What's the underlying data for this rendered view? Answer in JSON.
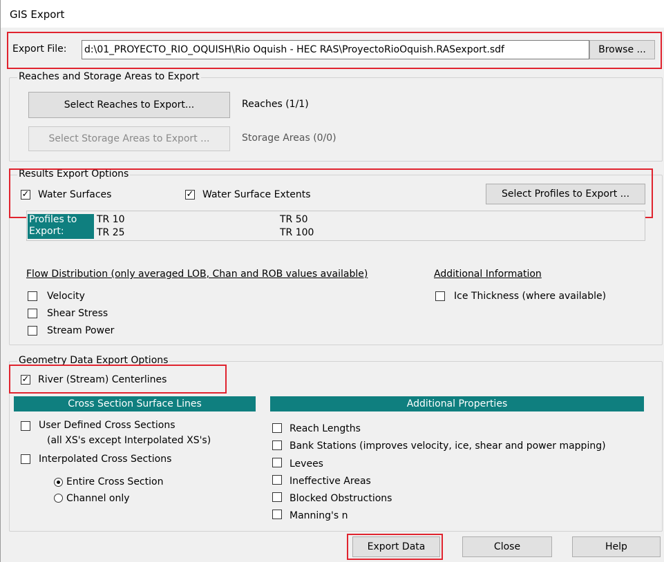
{
  "window": {
    "title": "GIS Export"
  },
  "export_file": {
    "label": "Export File:",
    "value": "d:\\01_PROYECTO_RIO_OQUISH\\Rio Oquish - HEC RAS\\ProyectoRioOquish.RASexport.sdf",
    "browse_label": "Browse ..."
  },
  "reaches_group": {
    "title": "Reaches and Storage Areas to Export",
    "select_reaches_label": "Select Reaches to Export...",
    "reaches_status": "Reaches (1/1)",
    "select_storage_label": "Select Storage Areas to Export ...",
    "storage_status": "Storage Areas (0/0)"
  },
  "results_group": {
    "title": "Results Export Options",
    "water_surfaces": {
      "label": "Water Surfaces",
      "checked": true
    },
    "water_surface_extents": {
      "label": "Water Surface Extents",
      "checked": true
    },
    "select_profiles_label": "Select Profiles to Export ...",
    "profiles_header_line1": "Profiles to",
    "profiles_header_line2": "Export:",
    "profiles": [
      "TR 10",
      "TR 50",
      "TR 25",
      "TR 100"
    ],
    "flow_distribution_title": "Flow Distribution (only averaged LOB, Chan and ROB values available)",
    "flow_options": [
      {
        "label": "Velocity",
        "checked": false
      },
      {
        "label": "Shear Stress",
        "checked": false
      },
      {
        "label": "Stream Power",
        "checked": false
      }
    ],
    "additional_info_title": "Additional Information",
    "ice_thickness": {
      "label": "Ice Thickness (where available)",
      "checked": false
    }
  },
  "geometry_group": {
    "title": "Geometry Data Export Options",
    "centerlines": {
      "label": "River (Stream) Centerlines",
      "checked": true
    },
    "xs_header": "Cross Section Surface Lines",
    "user_defined_xs": {
      "label": "User Defined Cross Sections",
      "sublabel": "(all XS's except Interpolated XS's)",
      "checked": false
    },
    "interpolated_xs": {
      "label": "Interpolated Cross Sections",
      "checked": false
    },
    "entire_xs": {
      "label": "Entire Cross Section",
      "selected": true
    },
    "channel_only": {
      "label": "Channel only",
      "selected": false
    },
    "additional_header": "Additional Properties",
    "additional_props": [
      {
        "label": "Reach Lengths",
        "checked": false
      },
      {
        "label": "Bank Stations (improves velocity, ice, shear and power mapping)",
        "checked": false
      },
      {
        "label": "Levees",
        "checked": false
      },
      {
        "label": "Ineffective Areas",
        "checked": false
      },
      {
        "label": "Blocked Obstructions",
        "checked": false
      },
      {
        "label": "Manning's n",
        "checked": false
      }
    ]
  },
  "footer": {
    "export_label": "Export Data",
    "close_label": "Close",
    "help_label": "Help"
  },
  "colors": {
    "teal_header": "#0f7f7f",
    "highlight": "#e0232e",
    "dialog_bg": "#f0f0f0"
  }
}
